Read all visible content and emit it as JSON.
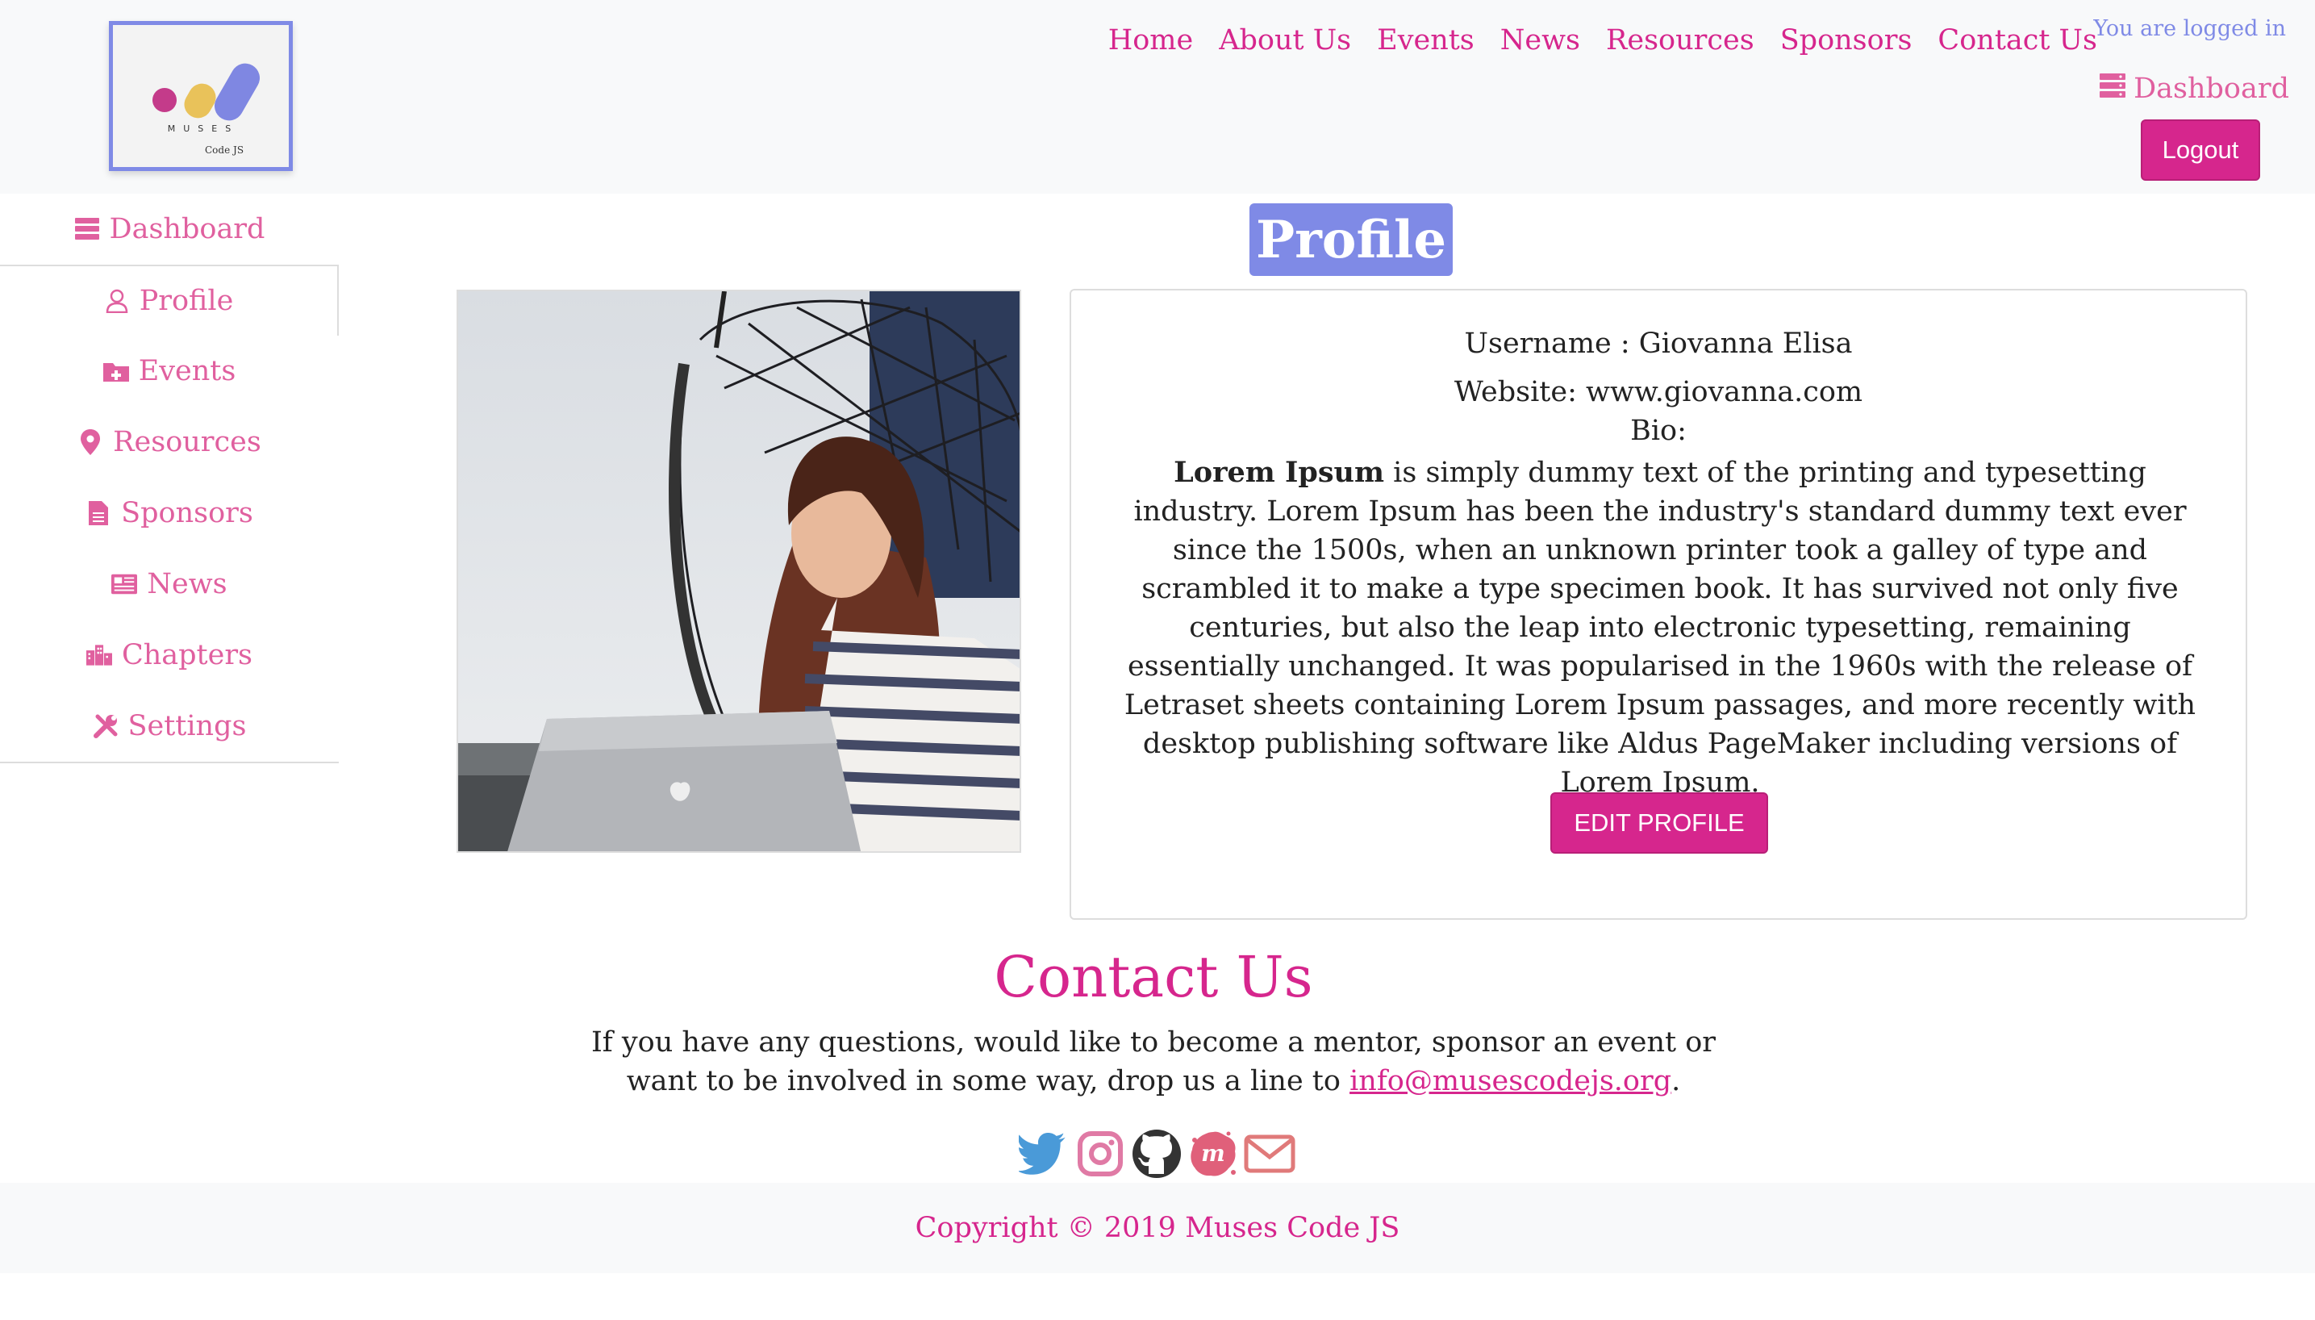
{
  "logo": {
    "name": "MUSES",
    "sub": "Code JS"
  },
  "nav": [
    "Home",
    "About Us",
    "Events",
    "News",
    "Resources",
    "Sponsors",
    "Contact Us"
  ],
  "header": {
    "logged_in_text": "You are logged in",
    "dashboard_label": "Dashboard",
    "logout_label": "Logout"
  },
  "sidebar": {
    "items": [
      {
        "label": "Dashboard",
        "icon": "server-icon"
      },
      {
        "label": "Profile",
        "icon": "user-icon"
      },
      {
        "label": "Events",
        "icon": "folder-plus-icon"
      },
      {
        "label": "Resources",
        "icon": "map-marker-icon"
      },
      {
        "label": "Sponsors",
        "icon": "file-icon"
      },
      {
        "label": "News",
        "icon": "newspaper-icon"
      },
      {
        "label": "Chapters",
        "icon": "city-icon"
      },
      {
        "label": "Settings",
        "icon": "tools-icon"
      }
    ]
  },
  "profile": {
    "title": "Profile",
    "username": "Username : Giovanna Elisa",
    "website": "Website: www.giovanna.com",
    "bio_label": "Bio:",
    "bio_bold": "Lorem Ipsum",
    "bio_text": " is simply dummy text of the printing and typesetting industry. Lorem Ipsum has been the industry's standard dummy text ever since the 1500s, when an unknown printer took a galley of type and scrambled it to make a type specimen book. It has survived not only five centuries, but also the leap into electronic typesetting, remaining essentially unchanged. It was popularised in the 1960s with the release of Letraset sheets containing Lorem Ipsum passages, and more recently with desktop publishing software like Aldus PageMaker including versions of Lorem Ipsum.",
    "edit_label": "EDIT PROFILE"
  },
  "contact": {
    "title": "Contact Us",
    "text": "If you have any questions, would like to become a mentor, sponsor an event or want to be involved in some way, drop us a line to ",
    "email": "info@musescodejs.org",
    "end": "."
  },
  "socials": [
    "twitter-icon",
    "instagram-icon",
    "github-icon",
    "meetup-icon",
    "envelope-icon"
  ],
  "colors": {
    "accent": "#d6268d",
    "secondary": "#7f8ae6",
    "link": "#e0609f",
    "twitter": "#4a9ad8",
    "instagram": "#e07aa5",
    "github": "#333333",
    "meetup": "#e0607a",
    "mail": "#e07a7a"
  },
  "footer": {
    "copyright": "Copyright © 2019 Muses Code JS"
  }
}
